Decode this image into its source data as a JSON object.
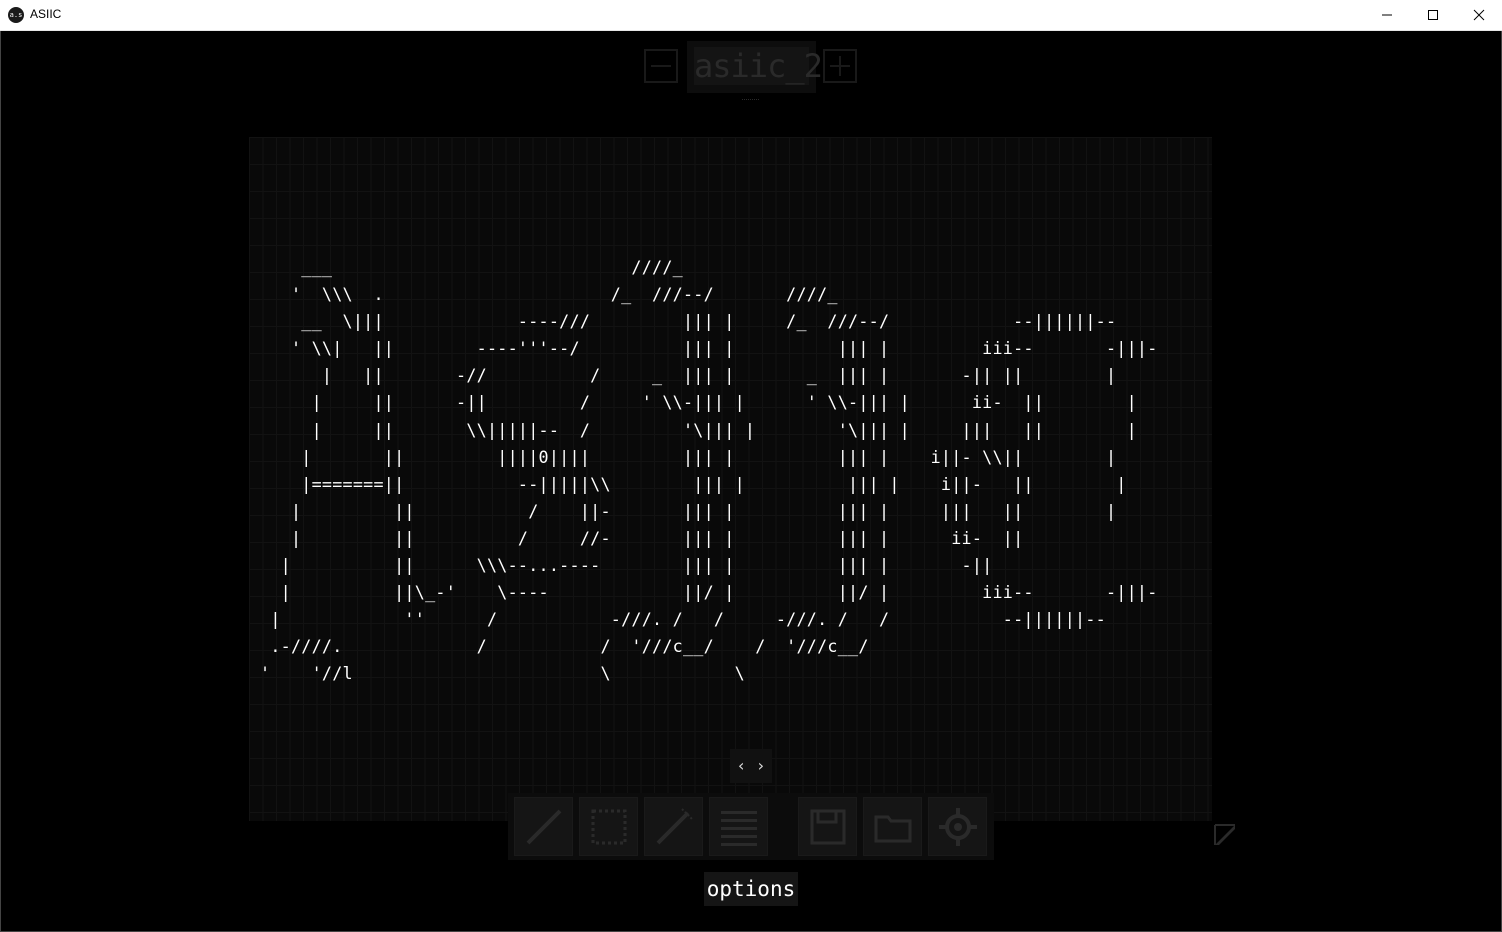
{
  "window": {
    "title": "ASIIC",
    "icon_text": "a.s"
  },
  "document": {
    "name": "asiic_2"
  },
  "canvas": {
    "ascii_art": "    ___                             ////_\n   '  \\\\\\  .                      /_  ///--/       ////_\n    __  \\|||             ----///         ||| |     /_  ///--/            --||||||--\n   ' \\\\|   ||        ----'''--/          ||| |          ||| |         iii--       -|||-\n      |   ||       -//          /     _  ||| |       _  ||| |       -|| ||        |\n     |     ||      -||         /     ' \\\\-||| |      ' \\\\-||| |      ii-  ||        |\n     |     ||       \\\\|||||--  /         '\\||| |        '\\||| |     |||   ||        |\n    |       ||         ||||0||||         ||| |          ||| |    i||- \\\\||        |\n    |=======||           --|||||\\\\        ||| |          ||| |    i||-   ||        |\n   |         ||           /    ||-       ||| |          ||| |     |||   ||        |\n   |         ||          /     //-       ||| |          ||| |      ii-  ||\n  |          ||      \\\\\\--...----        ||| |          ||| |       -||\n  |          ||\\_-'    \\----             ||/ |          ||/ |         iii--       -|||-\n |            ''      /           -///. /   /     -///. /   /           --||||||--\n .-////.             /           /  '///c__/    /  '///c__/\n'    '//l                        \\            \\",
    "nav_label": "‹ ›"
  },
  "toolbar": {
    "tools": [
      "pencil-tool",
      "selection-tool",
      "magic-wand-tool",
      "grid-tool",
      "save-tool",
      "open-folder-tool",
      "settings-tool"
    ]
  },
  "footer": {
    "options_label": "options"
  },
  "colors": {
    "background": "#000000",
    "canvas": "#090909",
    "grid": "#121212",
    "ascii": "#ffffff",
    "ui_dim": "#191919"
  }
}
